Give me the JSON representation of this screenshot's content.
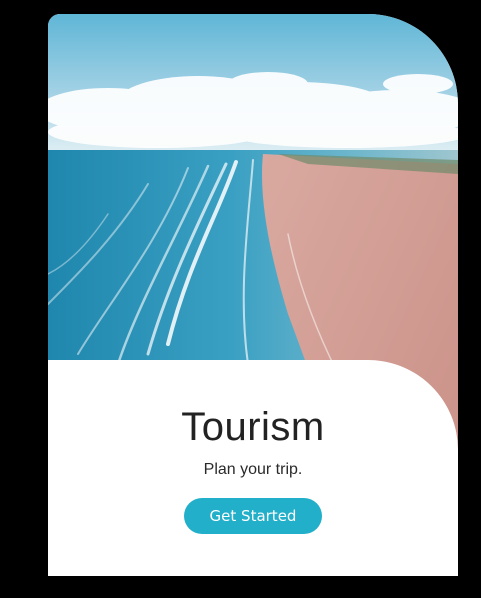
{
  "card": {
    "title": "Tourism",
    "subtitle": "Plan your trip.",
    "cta_label": "Get Started"
  },
  "colors": {
    "background": "#000000",
    "card": "#ffffff",
    "accent": "#21afc9",
    "title_text": "#222222"
  }
}
